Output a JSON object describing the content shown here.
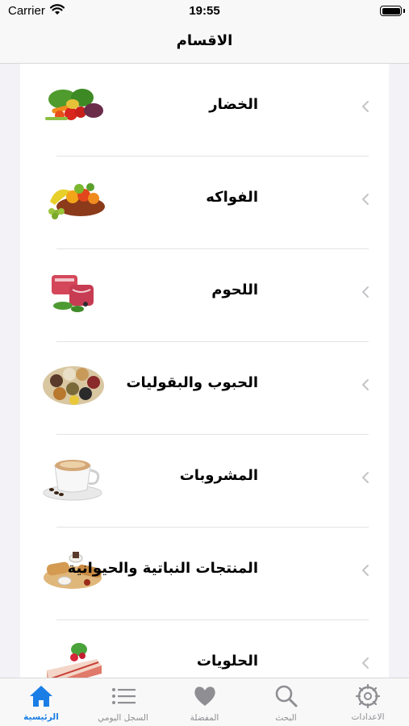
{
  "status_bar": {
    "carrier": "Carrier",
    "time": "19:55"
  },
  "nav": {
    "title": "الاقسام"
  },
  "categories": [
    {
      "label": "الخضار",
      "icon": "vegetables-image"
    },
    {
      "label": "الفواكه",
      "icon": "fruits-image"
    },
    {
      "label": "اللحوم",
      "icon": "meat-image"
    },
    {
      "label": "الحبوب والبقوليات",
      "icon": "grains-legumes-image"
    },
    {
      "label": "المشروبات",
      "icon": "coffee-cup-image"
    },
    {
      "label": "المنتجات النباتية والحيوانية",
      "icon": "plant-animal-products-image"
    },
    {
      "label": "الحلويات",
      "icon": "cake-slice-image"
    }
  ],
  "tabs": [
    {
      "label": "الاعدادات",
      "icon": "settings-gear-icon"
    },
    {
      "label": "البحث",
      "icon": "search-icon"
    },
    {
      "label": "المفضلة",
      "icon": "heart-icon"
    },
    {
      "label": "السجل اليومي",
      "icon": "list-icon"
    },
    {
      "label": "الرئيسية",
      "icon": "home-icon",
      "active": true
    }
  ],
  "colors": {
    "accent": "#1a7ee6",
    "inactive": "#8e8e93",
    "background": "#f2f2f7"
  }
}
